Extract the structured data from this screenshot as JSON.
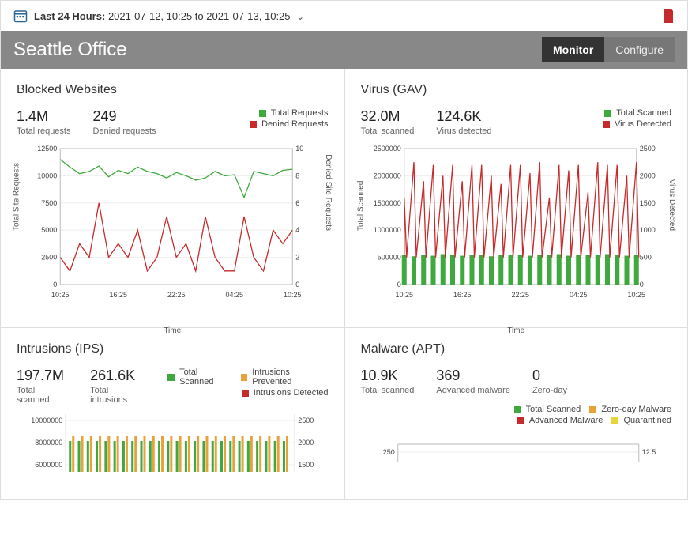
{
  "topbar": {
    "range_label": "Last 24 Hours:",
    "range_value": "2021-07-12, 10:25 to 2021-07-13, 10:25"
  },
  "header": {
    "title": "Seattle Office",
    "tabs": {
      "monitor": "Monitor",
      "configure": "Configure"
    }
  },
  "x_ticks": [
    "10:25",
    "16:25",
    "22:25",
    "04:25",
    "10:25"
  ],
  "legend": {
    "total_requests": "Total Requests",
    "denied_requests": "Denied Requests",
    "total_scanned": "Total Scanned",
    "virus_detected": "Virus Detected",
    "intrusions_prevented": "Intrusions Prevented",
    "intrusions_detected": "Intrusions Detected",
    "advanced_malware": "Advanced Malware",
    "zero_day_malware": "Zero-day Malware",
    "quarantined": "Quarantined"
  },
  "panels": {
    "blocked": {
      "title": "Blocked Websites",
      "stats": [
        {
          "value": "1.4M",
          "label": "Total requests"
        },
        {
          "value": "249",
          "label": "Denied requests"
        }
      ],
      "xlabel": "Time",
      "yleft_label": "Total Site Requests",
      "yright_label": "Denied Site Requests",
      "yleft_ticks": [
        "0",
        "2500",
        "5000",
        "7500",
        "10000",
        "12500"
      ],
      "yright_ticks": [
        "0",
        "2",
        "4",
        "6",
        "8",
        "10"
      ]
    },
    "virus": {
      "title": "Virus (GAV)",
      "stats": [
        {
          "value": "32.0M",
          "label": "Total scanned"
        },
        {
          "value": "124.6K",
          "label": "Virus detected"
        }
      ],
      "xlabel": "Time",
      "yleft_label": "Total Scanned",
      "yright_label": "Virus Detected",
      "yleft_ticks": [
        "0",
        "500000",
        "1000000",
        "1500000",
        "2000000",
        "2500000"
      ],
      "yright_ticks": [
        "0",
        "500",
        "1000",
        "1500",
        "2000",
        "2500"
      ]
    },
    "intrusions": {
      "title": "Intrusions (IPS)",
      "stats": [
        {
          "value": "197.7M",
          "label": "Total scanned"
        },
        {
          "value": "261.6K",
          "label": "Total intrusions"
        }
      ],
      "yleft_ticks": [
        "6000000",
        "8000000",
        "10000000"
      ],
      "yright_ticks": [
        "1500",
        "2000",
        "2500"
      ]
    },
    "malware": {
      "title": "Malware (APT)",
      "stats": [
        {
          "value": "10.9K",
          "label": "Total scanned"
        },
        {
          "value": "369",
          "label": "Advanced malware"
        },
        {
          "value": "0",
          "label": "Zero-day"
        }
      ],
      "yleft_ticks": [
        "250"
      ],
      "yright_ticks": [
        "12.5"
      ]
    }
  },
  "chart_data": [
    {
      "id": "blocked",
      "type": "line",
      "title": "Blocked Websites",
      "xlabel": "Time",
      "x": [
        "10:25",
        "11:25",
        "12:25",
        "13:25",
        "14:25",
        "15:25",
        "16:25",
        "17:25",
        "18:25",
        "19:25",
        "20:25",
        "21:25",
        "22:25",
        "23:25",
        "00:25",
        "01:25",
        "02:25",
        "03:25",
        "04:25",
        "05:25",
        "06:25",
        "07:25",
        "08:25",
        "09:25",
        "10:25"
      ],
      "series": [
        {
          "name": "Total Requests",
          "axis": "left",
          "ylim": [
            0,
            12500
          ],
          "ylabel": "Total Site Requests",
          "values": [
            11500,
            10800,
            10200,
            10400,
            10900,
            9900,
            10500,
            10200,
            10800,
            10400,
            10200,
            9800,
            10300,
            10000,
            9600,
            9800,
            10400,
            10000,
            10100,
            8000,
            10400,
            10200,
            10000,
            10500,
            10600
          ]
        },
        {
          "name": "Denied Requests",
          "axis": "right",
          "ylim": [
            0,
            10
          ],
          "ylabel": "Denied Site Requests",
          "values": [
            2,
            1,
            3,
            2,
            6,
            2,
            3,
            2,
            4,
            1,
            2,
            5,
            2,
            3,
            1,
            5,
            2,
            1,
            1,
            5,
            2,
            1,
            4,
            3,
            4
          ]
        }
      ]
    },
    {
      "id": "virus",
      "type": "line",
      "title": "Virus (GAV)",
      "xlabel": "Time",
      "x": [
        "10:25",
        "11:25",
        "12:25",
        "13:25",
        "14:25",
        "15:25",
        "16:25",
        "17:25",
        "18:25",
        "19:25",
        "20:25",
        "21:25",
        "22:25",
        "23:25",
        "00:25",
        "01:25",
        "02:25",
        "03:25",
        "04:25",
        "05:25",
        "06:25",
        "07:25",
        "08:25",
        "09:25",
        "10:25"
      ],
      "series": [
        {
          "name": "Total Scanned",
          "axis": "left",
          "ylim": [
            0,
            2500000
          ],
          "ylabel": "Total Scanned",
          "values": [
            550000,
            520000,
            540000,
            530000,
            560000,
            540000,
            530000,
            550000,
            540000,
            520000,
            550000,
            540000,
            540000,
            530000,
            550000,
            540000,
            560000,
            530000,
            540000,
            540000,
            540000,
            560000,
            540000,
            530000,
            540000
          ]
        },
        {
          "name": "Virus Detected",
          "axis": "right",
          "ylim": [
            0,
            2500
          ],
          "ylabel": "Virus Detected",
          "values": [
            1600,
            2250,
            1900,
            2200,
            2000,
            2200,
            1900,
            2200,
            2200,
            2000,
            1850,
            2200,
            2200,
            2050,
            2250,
            1600,
            2200,
            2100,
            2200,
            1700,
            2250,
            2200,
            2200,
            2000,
            2250
          ]
        }
      ]
    },
    {
      "id": "intrusions",
      "type": "bar",
      "title": "Intrusions (IPS)",
      "x": [
        "10:25",
        "11:25",
        "12:25",
        "13:25",
        "14:25",
        "15:25",
        "16:25",
        "17:25",
        "18:25",
        "19:25",
        "20:25",
        "21:25",
        "22:25",
        "23:25",
        "00:25",
        "01:25",
        "02:25",
        "03:25",
        "04:25",
        "05:25",
        "06:25",
        "07:25",
        "08:25",
        "09:25",
        "10:25"
      ],
      "series": [
        {
          "name": "Total Scanned",
          "axis": "left",
          "ylim": [
            0,
            10000000
          ],
          "values": [
            8200000,
            8200000,
            8200000,
            8200000,
            8200000,
            8200000,
            8200000,
            8200000,
            8200000,
            8200000,
            8200000,
            8200000,
            8200000,
            8200000,
            8200000,
            8200000,
            8200000,
            8200000,
            8200000,
            8200000,
            8200000,
            8200000,
            8200000,
            8200000,
            8200000
          ]
        },
        {
          "name": "Intrusions Prevented",
          "axis": "right",
          "ylim": [
            0,
            2500
          ],
          "values": [
            2150,
            2150,
            2150,
            2150,
            2150,
            2150,
            2150,
            2150,
            2150,
            2150,
            2150,
            2150,
            2150,
            2150,
            2150,
            2150,
            2150,
            2150,
            2150,
            2150,
            2150,
            2150,
            2150,
            2150,
            2150
          ]
        },
        {
          "name": "Intrusions Detected",
          "axis": "right",
          "ylim": [
            0,
            2500
          ],
          "values": [
            2150,
            2150,
            2150,
            2150,
            2150,
            2150,
            2150,
            2150,
            2150,
            2150,
            2150,
            2150,
            2150,
            2150,
            2150,
            2150,
            2150,
            2150,
            2150,
            2150,
            2150,
            2150,
            2150,
            2150,
            2150
          ]
        }
      ]
    },
    {
      "id": "malware",
      "type": "bar",
      "title": "Malware (APT)",
      "series": [
        {
          "name": "Total Scanned"
        },
        {
          "name": "Advanced Malware"
        },
        {
          "name": "Zero-day Malware"
        },
        {
          "name": "Quarantined"
        }
      ]
    }
  ]
}
